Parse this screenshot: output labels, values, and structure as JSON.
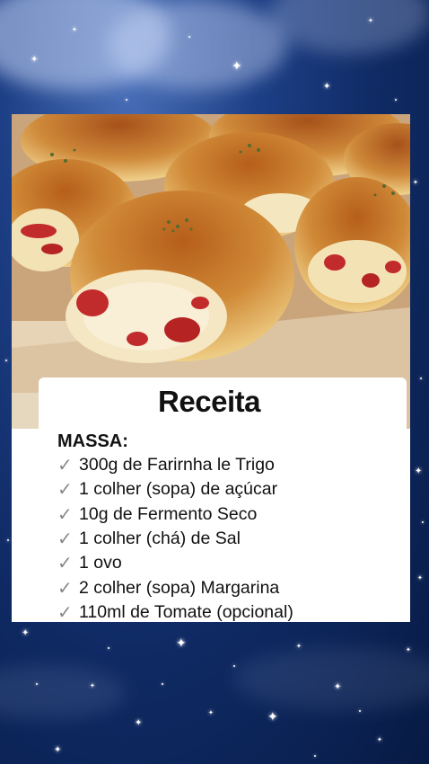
{
  "recipe": {
    "title": "Receita",
    "section": "MASSA:",
    "check_icon": "✓",
    "ingredients": [
      "300g de Farirnha le Trigo",
      "1 colher (sopa) de açúcar",
      "10g de Fermento Seco",
      "1 colher (chá) de Sal",
      "1 ovo",
      "2 colher (sopa) Margarina",
      "110ml de Tomate (opcional)"
    ]
  },
  "photo": {
    "subject": "stuffed bread rolls"
  },
  "colors": {
    "sky": "#0f2a63",
    "card": "#ffffff",
    "bread": "#c8822e"
  }
}
